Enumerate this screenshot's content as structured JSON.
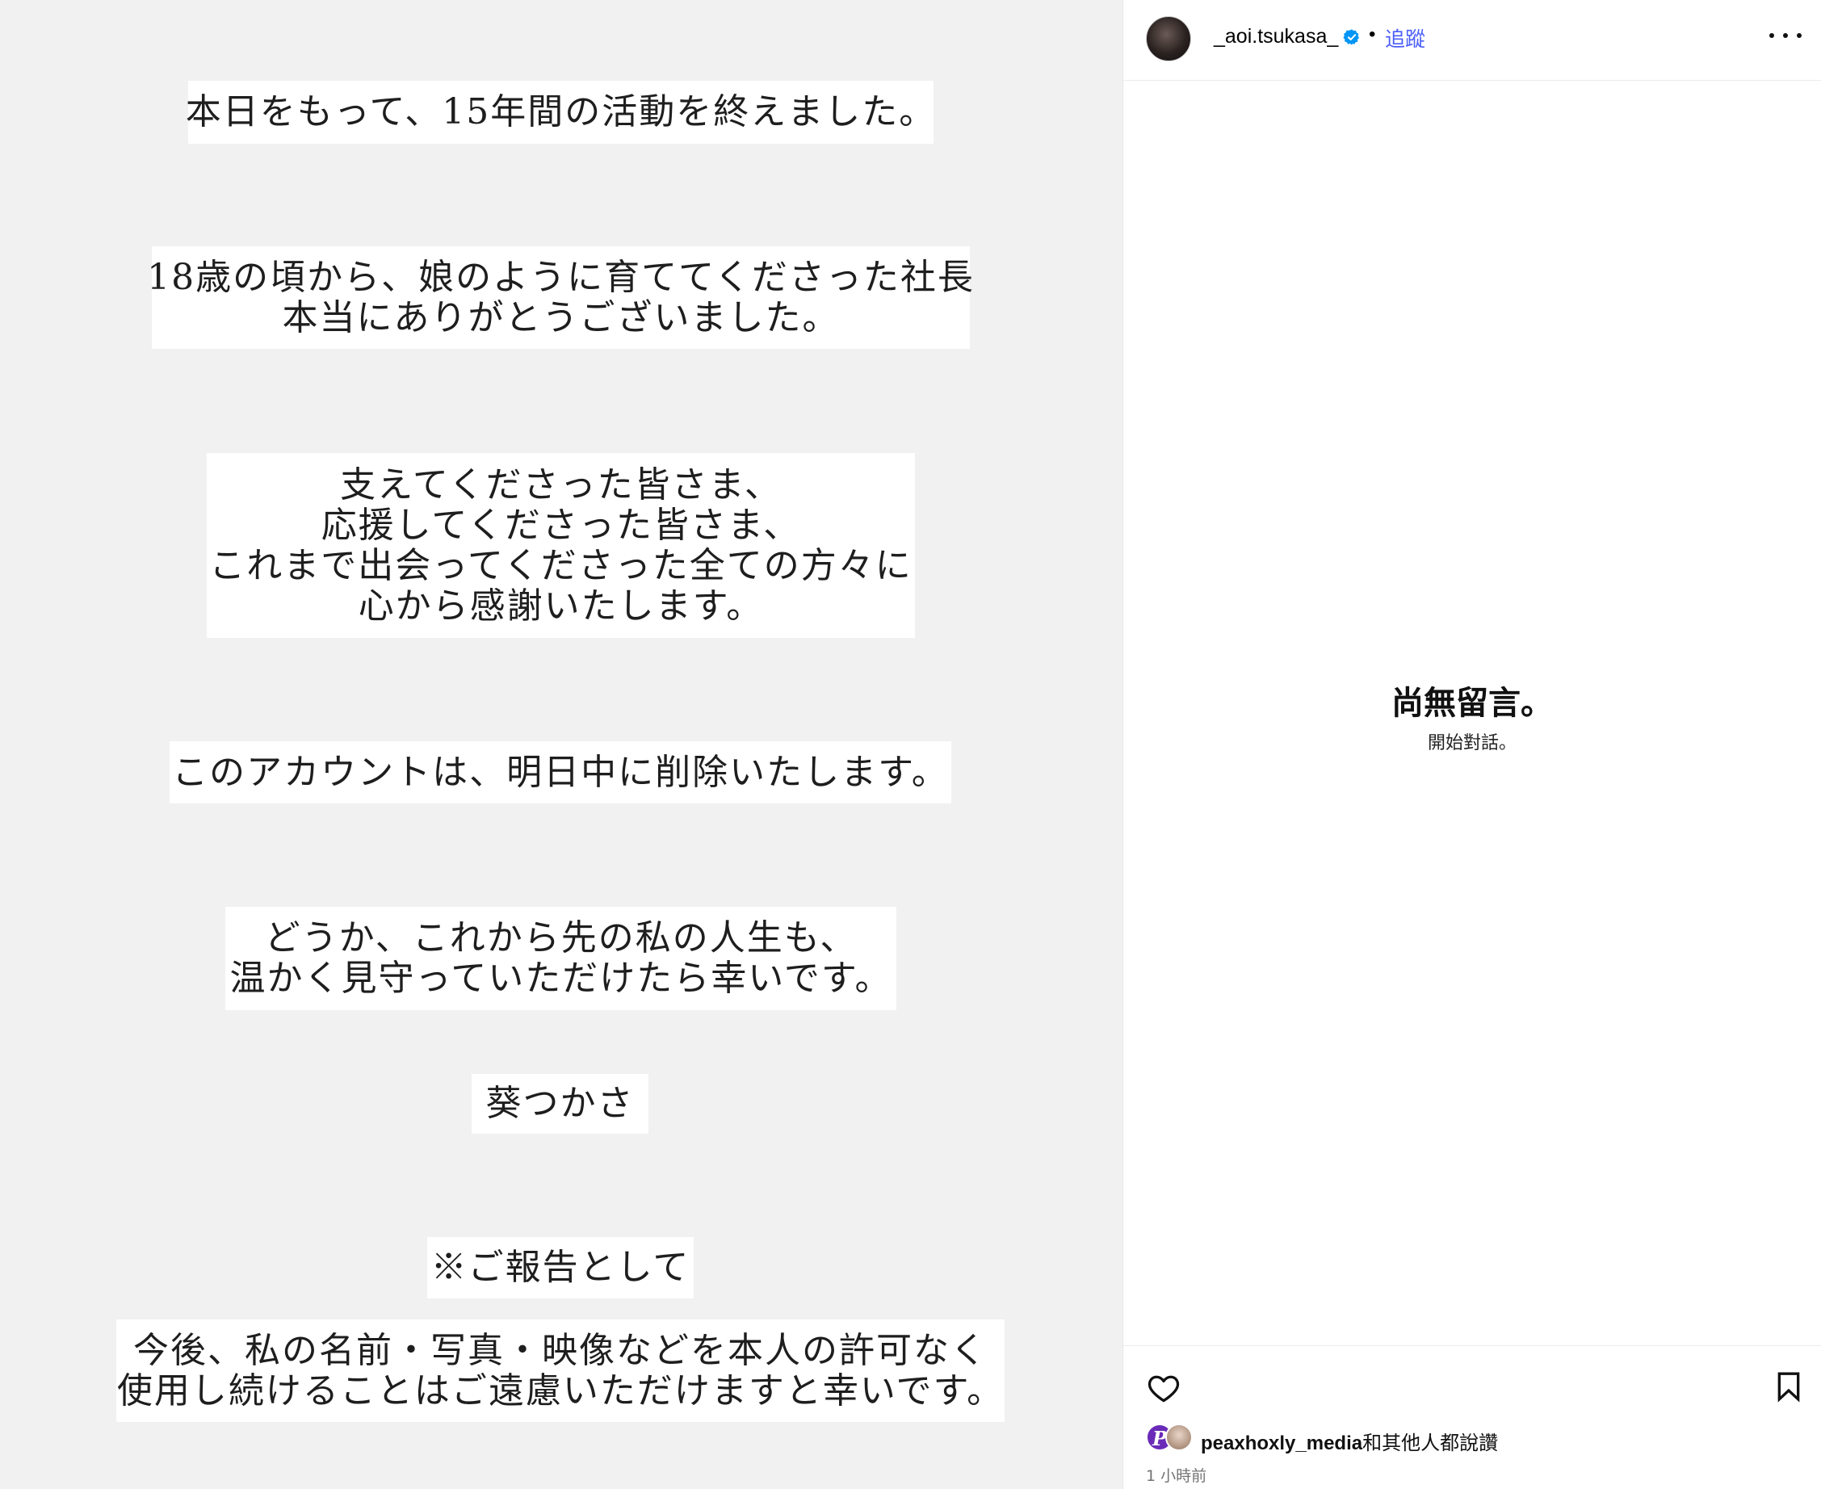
{
  "post": {
    "lines": [
      [
        "本日をもって、15年間の活動を終えました。"
      ],
      [
        "18歳の頃から、娘のように育ててくださった社長",
        "本当にありがとうございました。"
      ],
      [
        "支えてくださった皆さま、",
        "応援してくださった皆さま、",
        "これまで出会ってくださった全ての方々に",
        "心から感謝いたします。"
      ],
      [
        "このアカウントは、明日中に削除いたします。"
      ],
      [
        "どうか、これから先の私の人生も、",
        "温かく見守っていただけたら幸いです。"
      ],
      [
        "葵つかさ"
      ],
      [
        "※ご報告として"
      ],
      [
        "今後、私の名前・写真・映像などを本人の許可なく",
        "使用し続けることはご遠慮いただけますと幸いです。"
      ]
    ]
  },
  "header": {
    "username": "_aoi.tsukasa_",
    "separator": "•",
    "follow_label": "追蹤"
  },
  "comments": {
    "empty_title": "尚無留言。",
    "empty_subtitle": "開始對話。"
  },
  "footer": {
    "liker_initial": "P",
    "liker_name": "peaxhoxly_media",
    "likes_suffix": "和其他人都說讚",
    "timestamp": "1 小時前"
  },
  "colors": {
    "accent": "#4a5df9",
    "verified": "#0095f6",
    "media_bg": "#f1f1f1"
  }
}
